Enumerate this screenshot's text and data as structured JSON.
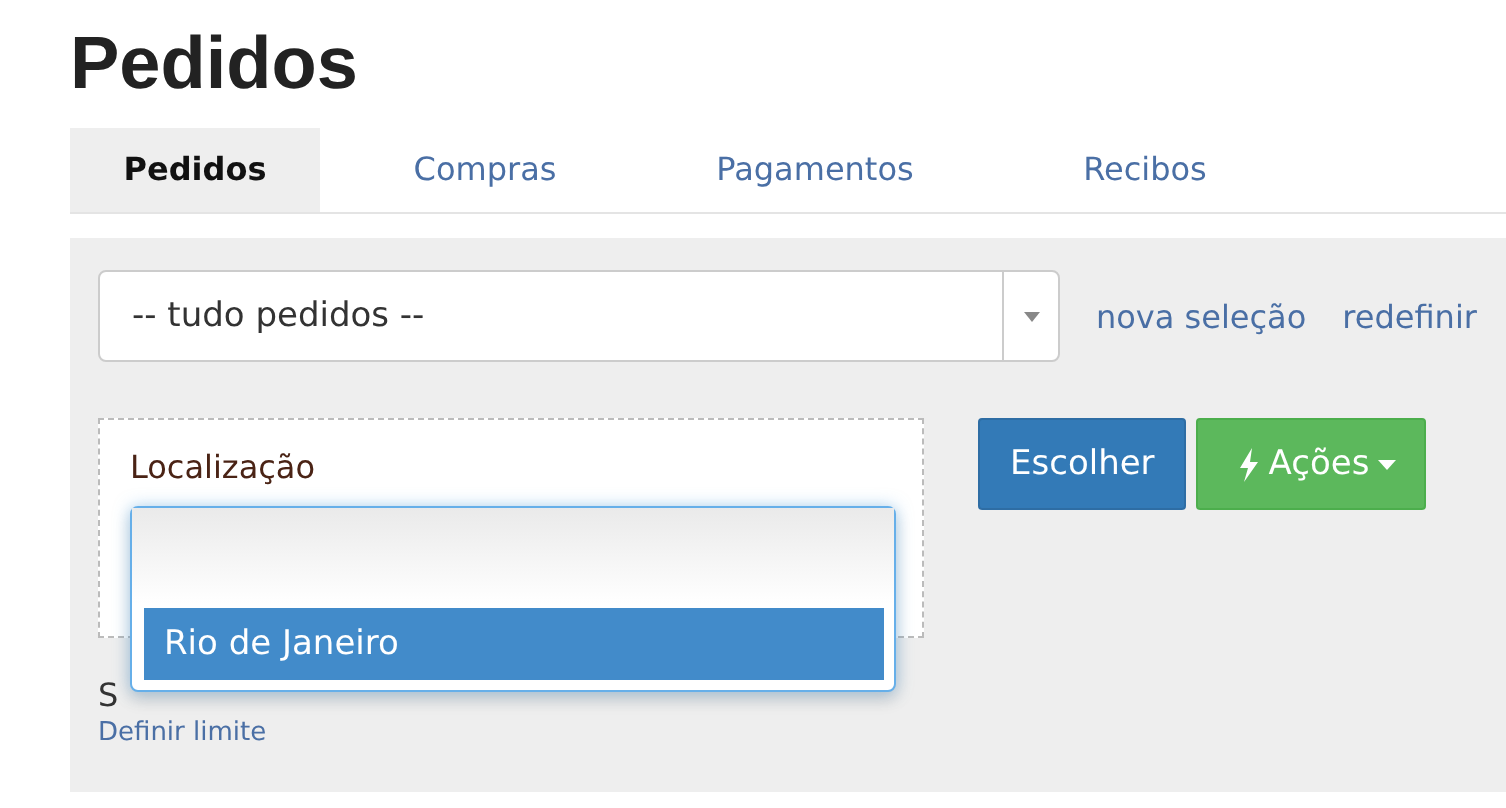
{
  "title": "Pedidos",
  "tabs": [
    {
      "label": "Pedidos",
      "selected": true
    },
    {
      "label": "Compras",
      "selected": false
    },
    {
      "label": "Pagamentos",
      "selected": false
    },
    {
      "label": "Recibos",
      "selected": false
    }
  ],
  "filter": {
    "value": "-- tudo pedidos --",
    "links": [
      "nova seleção",
      "redefinir"
    ]
  },
  "location": {
    "label": "Localização",
    "expanded": true,
    "options": [
      {
        "label": "Rio de Janeiro",
        "selected": true
      }
    ]
  },
  "buttons": [
    {
      "label": "Escolher",
      "kind": "primary"
    },
    {
      "label": "Ações",
      "kind": "actions"
    }
  ],
  "rule_text": "S",
  "limit_link": "Definir limite"
}
